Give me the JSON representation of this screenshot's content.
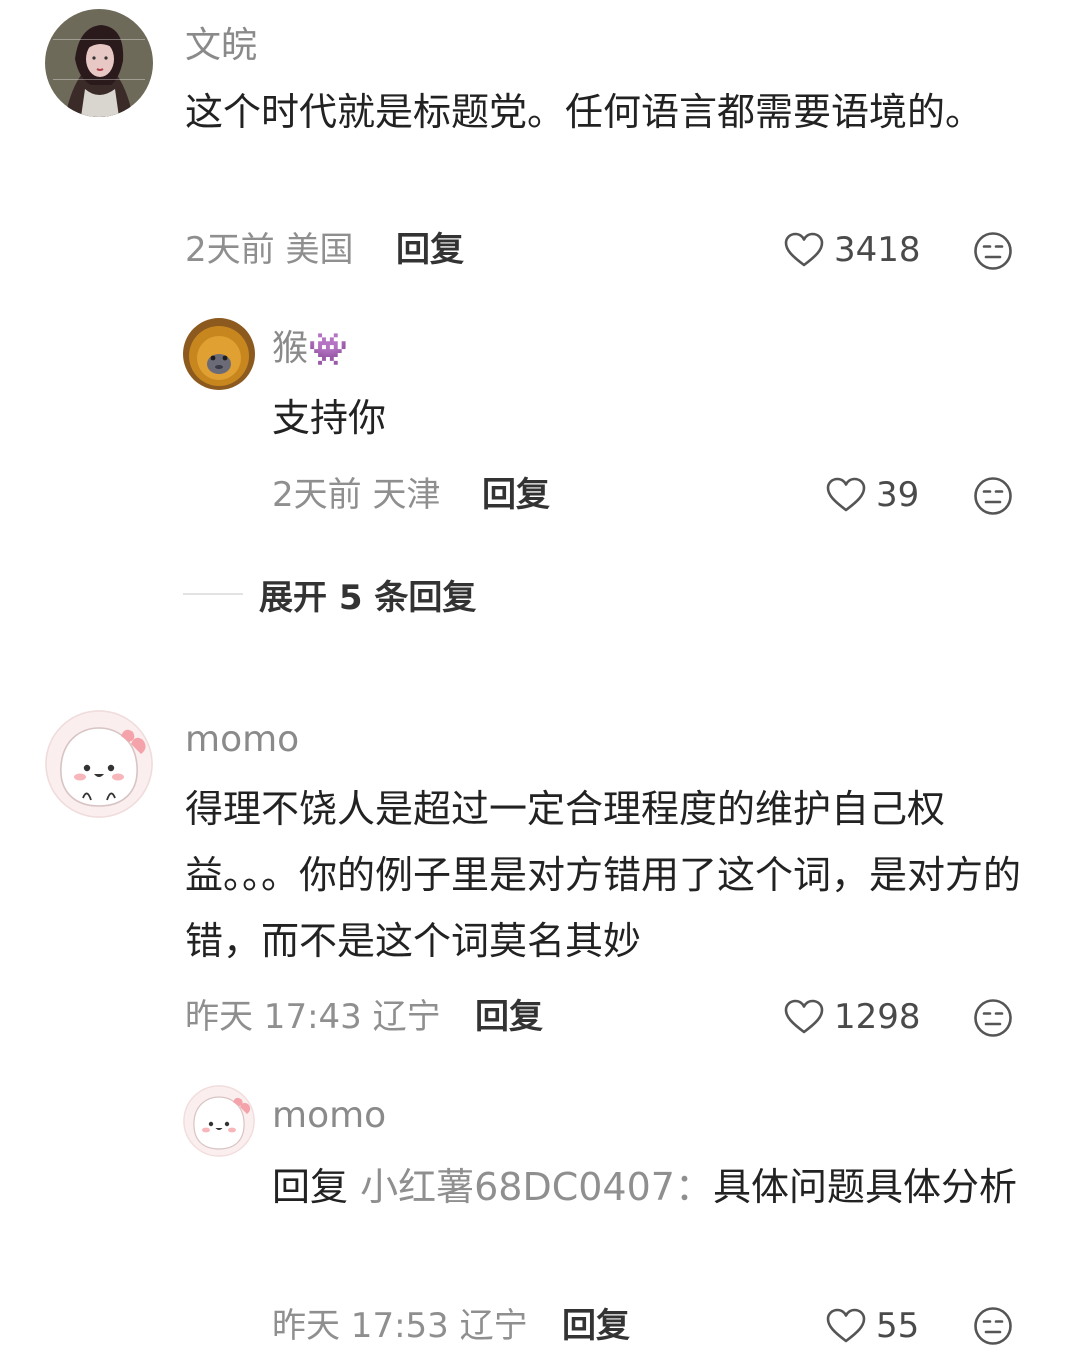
{
  "comments": [
    {
      "author": "文皖",
      "text": "这个时代就是标题党。任何语言都需要语境的。",
      "time": "2天前",
      "location": "美国",
      "reply_label": "回复",
      "likes": "3418",
      "replies": [
        {
          "author": "猴",
          "author_badge": "👾",
          "text": "支持你",
          "time": "2天前",
          "location": "天津",
          "reply_label": "回复",
          "likes": "39"
        }
      ],
      "expand_label": "展开 5 条回复"
    },
    {
      "author": "momo",
      "text": "得理不饶人是超过一定合理程度的维护自己权益。。。你的例子里是对方错用了这个词，是对方的错，而不是这个词莫名其妙",
      "time": "昨天 17:43",
      "location": "辽宁",
      "reply_label": "回复",
      "likes": "1298",
      "replies": [
        {
          "author": "momo",
          "reply_prefix": "回复",
          "reply_target": "小红薯68DC0407：",
          "text": "具体问题具体分析",
          "time": "昨天 17:53",
          "location": "辽宁",
          "reply_label": "回复",
          "likes": "55"
        }
      ]
    }
  ],
  "icons": {
    "like": "heart-outline-icon",
    "dislike": "meh-face-icon"
  },
  "colors": {
    "name": "#8a8a8a",
    "text": "#222222",
    "meta": "#8f8f8f"
  }
}
